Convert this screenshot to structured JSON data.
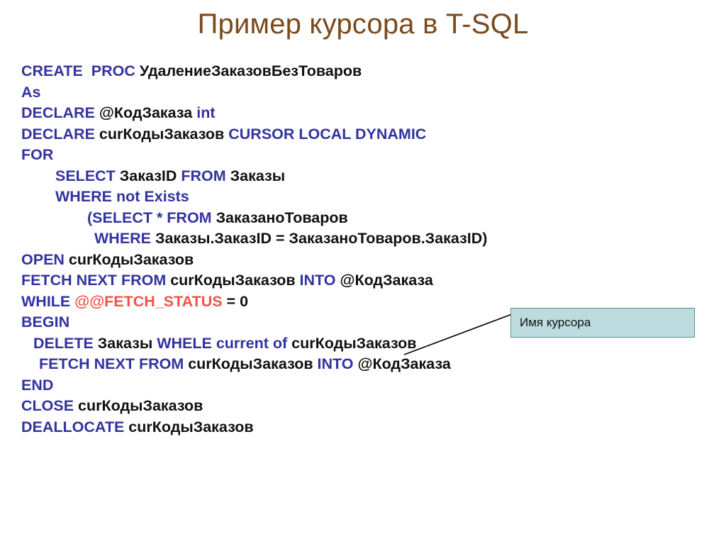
{
  "slide": {
    "title": "Пример курсора в T-SQL",
    "title_color": "#7B4A1B",
    "background_color": "#FFFFFF"
  },
  "colors": {
    "keyword": "#3333A0",
    "identifier": "#111111",
    "system_variable": "#F2534A",
    "callout_fill": "#BCDCDF",
    "callout_border": "#5E8E91",
    "leader_line": "#000000"
  },
  "code": {
    "lines": [
      {
        "indent": 0,
        "tokens": [
          {
            "t": "CREATE  PROC ",
            "k": "kw"
          },
          {
            "t": "УдалениеЗаказовБезТоваров",
            "k": "id"
          }
        ]
      },
      {
        "indent": 0,
        "tokens": [
          {
            "t": "As",
            "k": "kw"
          }
        ]
      },
      {
        "indent": 0,
        "tokens": [
          {
            "t": "DECLARE ",
            "k": "kw"
          },
          {
            "t": "@КодЗаказа ",
            "k": "id"
          },
          {
            "t": "int",
            "k": "kw"
          }
        ]
      },
      {
        "indent": 0,
        "tokens": [
          {
            "t": "DECLARE ",
            "k": "kw"
          },
          {
            "t": "curКодыЗаказов ",
            "k": "id"
          },
          {
            "t": "CURSOR LOCAL DYNAMIC",
            "k": "kw"
          }
        ]
      },
      {
        "indent": 0,
        "tokens": [
          {
            "t": "FOR",
            "k": "kw"
          }
        ]
      },
      {
        "indent": 1,
        "tokens": [
          {
            "t": "SELECT ",
            "k": "kw"
          },
          {
            "t": "ЗаказID ",
            "k": "id"
          },
          {
            "t": "FROM ",
            "k": "kw"
          },
          {
            "t": "Заказы",
            "k": "id"
          }
        ]
      },
      {
        "indent": 1,
        "tokens": [
          {
            "t": "WHERE not Exists",
            "k": "kw"
          }
        ]
      },
      {
        "indent": 2,
        "tokens": [
          {
            "t": "(SELECT * FROM ",
            "k": "kw"
          },
          {
            "t": "ЗаказаноТоваров",
            "k": "id"
          }
        ]
      },
      {
        "indent": 3,
        "tokens": [
          {
            "t": "WHERE ",
            "k": "kw"
          },
          {
            "t": "Заказы.ЗаказID = ЗаказаноТоваров.ЗаказID)",
            "k": "id"
          }
        ]
      },
      {
        "indent": 0,
        "tokens": [
          {
            "t": "OPEN ",
            "k": "kw"
          },
          {
            "t": "curКодыЗаказов",
            "k": "id"
          }
        ]
      },
      {
        "indent": 0,
        "tokens": [
          {
            "t": "FETCH NEXT FROM ",
            "k": "kw"
          },
          {
            "t": "curКодыЗаказов ",
            "k": "id"
          },
          {
            "t": "INTO ",
            "k": "kw"
          },
          {
            "t": "@КодЗаказа",
            "k": "id"
          }
        ]
      },
      {
        "indent": 0,
        "tokens": [
          {
            "t": "WHILE ",
            "k": "kw"
          },
          {
            "t": "@@FETCH_STATUS",
            "k": "sys"
          },
          {
            "t": " = 0",
            "k": "id"
          }
        ]
      },
      {
        "indent": 0,
        "tokens": [
          {
            "t": "BEGIN",
            "k": "kw"
          }
        ]
      },
      {
        "indent": 4,
        "tokens": [
          {
            "t": "DELETE ",
            "k": "kw"
          },
          {
            "t": "Заказы ",
            "k": "id"
          },
          {
            "t": "WHELE current of ",
            "k": "kw"
          },
          {
            "t": "curКодыЗаказов",
            "k": "id"
          }
        ]
      },
      {
        "indent": 5,
        "tokens": [
          {
            "t": "FETCH NEXT FROM ",
            "k": "kw"
          },
          {
            "t": "curКодыЗаказов ",
            "k": "id"
          },
          {
            "t": "INTO ",
            "k": "kw"
          },
          {
            "t": "@КодЗаказа",
            "k": "id"
          }
        ]
      },
      {
        "indent": 0,
        "tokens": [
          {
            "t": "END",
            "k": "kw"
          }
        ]
      },
      {
        "indent": 0,
        "tokens": [
          {
            "t": "CLOSE ",
            "k": "kw"
          },
          {
            "t": "curКодыЗаказов",
            "k": "id"
          }
        ]
      },
      {
        "indent": 0,
        "tokens": [
          {
            "t": "DEALLOCATE ",
            "k": "kw"
          },
          {
            "t": "curКодыЗаказов",
            "k": "id"
          }
        ]
      }
    ]
  },
  "callout": {
    "label": "Имя курсора"
  }
}
